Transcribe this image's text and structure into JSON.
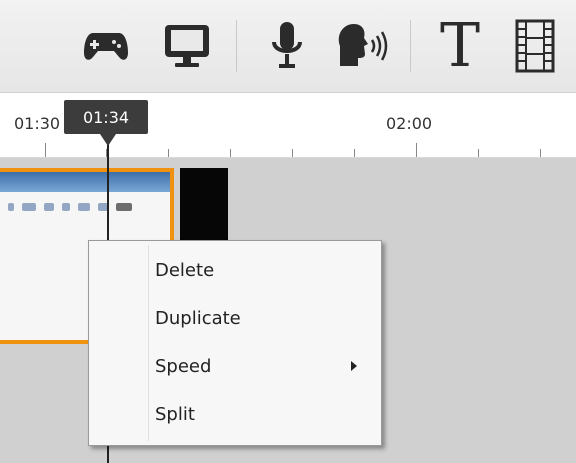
{
  "toolbar": {
    "icons": [
      {
        "name": "gamepad-icon"
      },
      {
        "name": "monitor-icon"
      },
      {
        "name": "microphone-icon"
      },
      {
        "name": "voice-narration-icon"
      },
      {
        "name": "text-icon",
        "glyph": "T"
      },
      {
        "name": "film-strip-icon"
      }
    ]
  },
  "timeline": {
    "ruler_labels": [
      "01:30",
      "02:00"
    ],
    "playhead_time": "01:34"
  },
  "context_menu": {
    "items": [
      {
        "label": "Delete"
      },
      {
        "label": "Duplicate"
      },
      {
        "label": "Speed",
        "has_submenu": true
      },
      {
        "label": "Split"
      }
    ]
  },
  "colors": {
    "clip_border": "#f0920f",
    "playhead": "#3c3c3c"
  }
}
